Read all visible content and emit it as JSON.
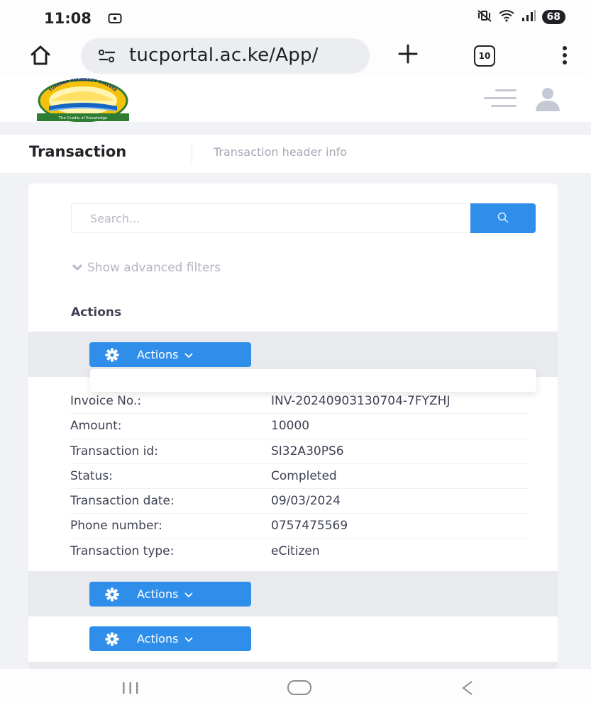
{
  "status_bar": {
    "time": "11:08",
    "battery": "68",
    "icons": [
      "screen-cast-icon",
      "mute-vibrate-icon",
      "wifi-icon",
      "signal-icon"
    ]
  },
  "browser": {
    "url": "tucportal.ac.ke/App/",
    "tab_count": "10",
    "icons": [
      "home-icon",
      "site-info-icon",
      "plus-icon",
      "tab-switcher-icon",
      "more-vert-icon"
    ]
  },
  "header": {
    "logo_text": "The Cradle of Knowledge",
    "logo_arc": "TURKANA UNIVERSITY COLLEGE"
  },
  "subheader": {
    "title": "Transaction",
    "description": "Transaction header info"
  },
  "search": {
    "placeholder": "Search..."
  },
  "filters": {
    "toggle_label": "Show advanced filters"
  },
  "actions_section": {
    "label": "Actions",
    "button_label": "Actions"
  },
  "transaction": {
    "fields": [
      {
        "key": "Invoice No.:",
        "value": "INV-20240903130704-7FYZHJ"
      },
      {
        "key": "Amount:",
        "value": "10000"
      },
      {
        "key": "Transaction id:",
        "value": "SI32A30PS6"
      },
      {
        "key": "Status:",
        "value": "Completed"
      },
      {
        "key": "Transaction date:",
        "value": "09/03/2024"
      },
      {
        "key": "Phone number:",
        "value": "0757475569"
      },
      {
        "key": "Transaction type:",
        "value": "eCitizen"
      }
    ]
  },
  "colors": {
    "primary": "#2f8ee9",
    "page_bg": "#f1f2f6",
    "row_band": "#e8eaed",
    "text": "#3f4254",
    "muted": "#b5b5c3"
  }
}
